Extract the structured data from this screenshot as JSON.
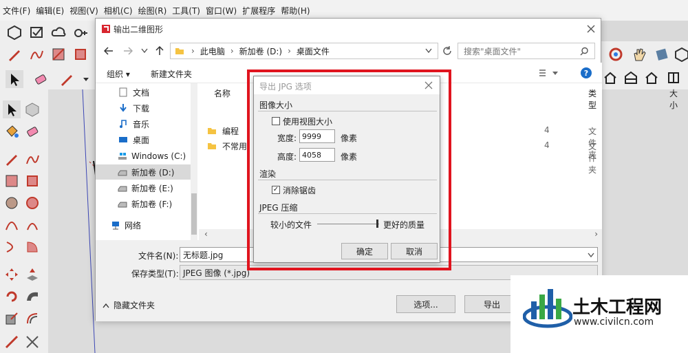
{
  "menu": [
    "文件(F)",
    "编辑(E)",
    "视图(V)",
    "相机(C)",
    "绘图(R)",
    "工具(T)",
    "窗口(W)",
    "扩展程序",
    "帮助(H)"
  ],
  "save_dialog": {
    "title": "输出二维图形",
    "breadcrumb": [
      "此电脑",
      "新加卷 (D:)",
      "桌面文件"
    ],
    "search_placeholder": "搜索\"桌面文件\"",
    "organize": "组织 ▾",
    "new_folder": "新建文件夹",
    "nav_items": [
      "文档",
      "下载",
      "音乐",
      "桌面",
      "Windows (C:)",
      "新加卷 (D:)",
      "新加卷 (E:)",
      "新加卷 (F:)",
      "网络"
    ],
    "columns": {
      "name": "名称",
      "type": "类型",
      "size": "大小"
    },
    "files": [
      {
        "name": "编程",
        "date_tail": "4",
        "type": "文件夹"
      },
      {
        "name": "不常用",
        "date_tail": "4",
        "type": "文件夹"
      }
    ],
    "filename_label": "文件名(N):",
    "filename_value": "无标题.jpg",
    "filetype_label": "保存类型(T):",
    "filetype_value": "JPEG 图像 (*.jpg)",
    "hide_folders": "隐藏文件夹",
    "options_button": "选项...",
    "export_button": "导出"
  },
  "jpg_dialog": {
    "title": "导出 JPG 选项",
    "image_size": "图像大小",
    "use_view_size": "使用视图大小",
    "width_label": "宽度:",
    "width_value": "9999",
    "height_label": "高度:",
    "height_value": "4058",
    "unit": "像素",
    "render": "渲染",
    "antialias": "消除锯齿",
    "jpeg_compression": "JPEG 压缩",
    "smaller_file": "较小的文件",
    "better_quality": "更好的质量",
    "ok": "确定",
    "cancel": "取消"
  },
  "watermark": {
    "name": "土木工程网",
    "url": "www.civilcn.com"
  },
  "colors": {
    "highlight": "#e0141e",
    "watermark_blue": "#1f5fa8",
    "watermark_green": "#3aa845"
  }
}
